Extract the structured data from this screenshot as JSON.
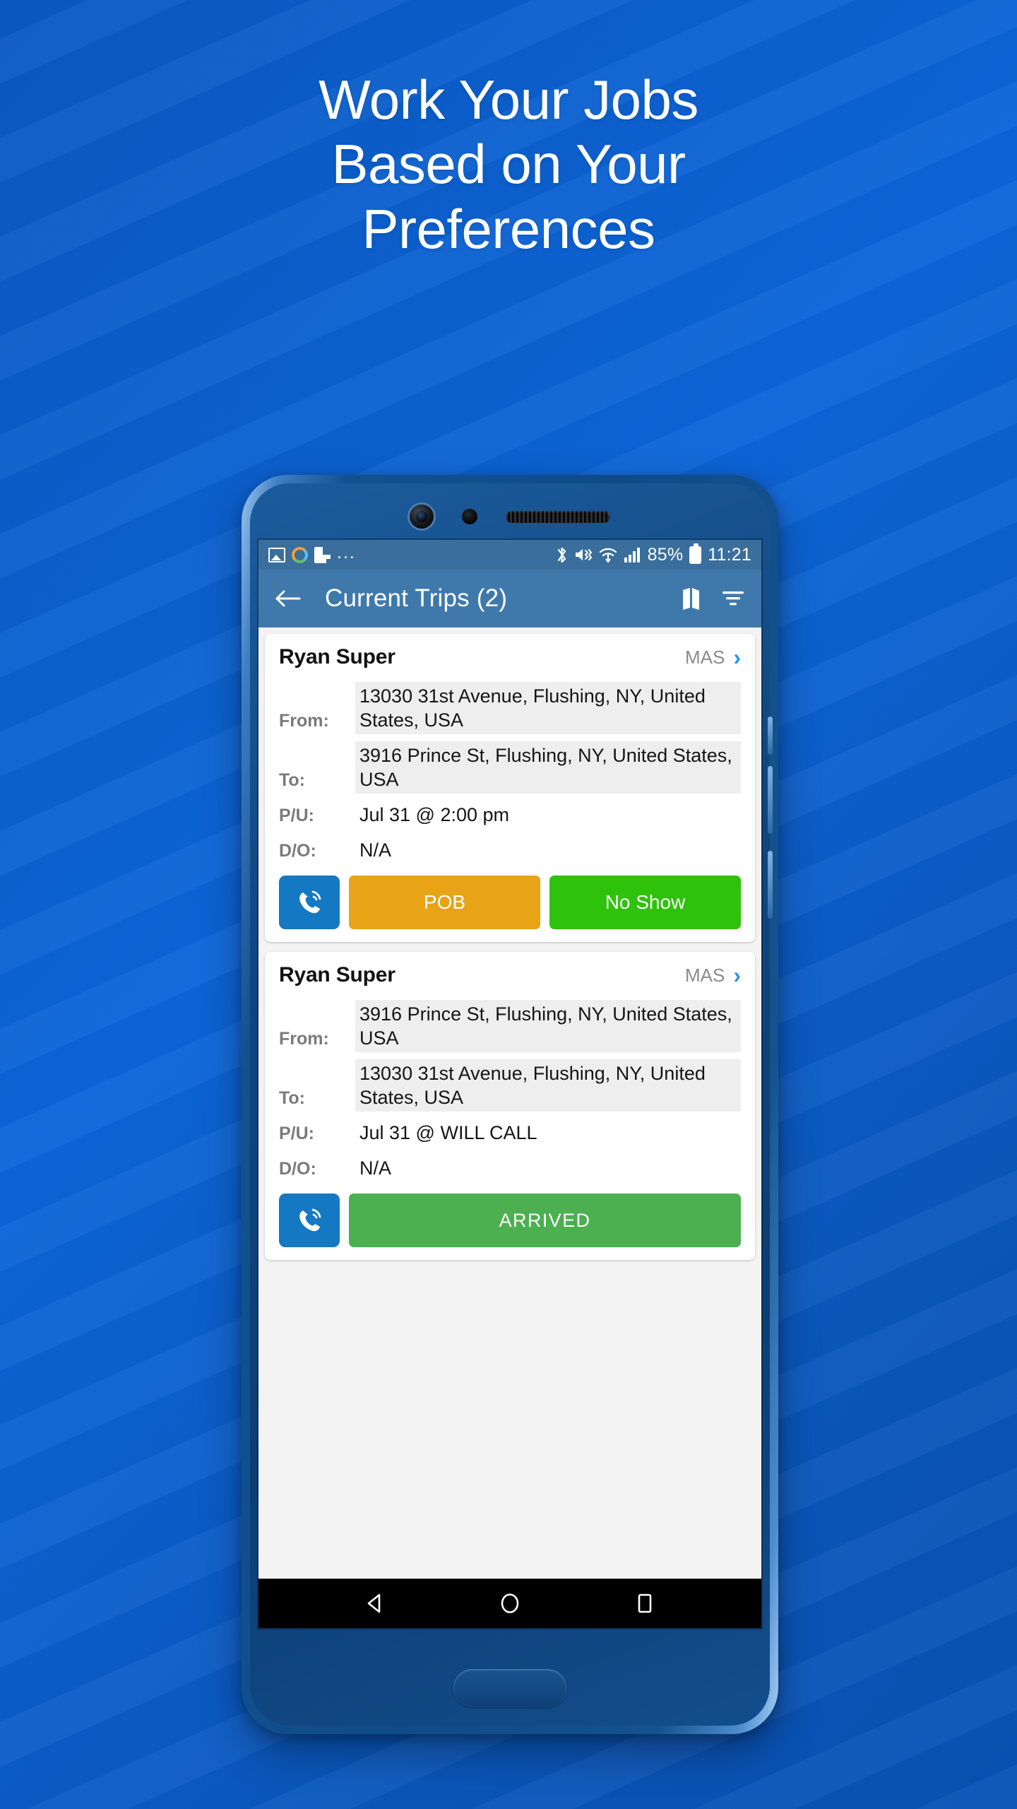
{
  "headline": {
    "line1": "Work Your Jobs",
    "line2": "Based on Your",
    "line3": "Preferences"
  },
  "status_bar": {
    "left_icons": [
      "photo-icon",
      "ring-icon",
      "flipboard-icon"
    ],
    "overflow": "...",
    "right_icons": [
      "bluetooth-icon",
      "vibrate-mute-icon",
      "wifi-icon",
      "signal-icon"
    ],
    "battery_percent": "85%",
    "battery_icon": "battery-icon",
    "time": "11:21"
  },
  "app_bar": {
    "back_icon": "back-arrow-icon",
    "title": "Current Trips (2)",
    "map_icon": "map-icon",
    "filter_icon": "filter-icon"
  },
  "trips": [
    {
      "name": "Ryan Super",
      "tag": "MAS",
      "chevron": "›",
      "rows": [
        {
          "label": "From:",
          "value": "13030 31st Avenue, Flushing, NY, United States, USA",
          "shaded": true
        },
        {
          "label": "To:",
          "value": "3916 Prince St, Flushing, NY, United States, USA",
          "shaded": true
        },
        {
          "label": "P/U:",
          "value": "Jul 31 @ 2:00 pm",
          "shaded": false
        },
        {
          "label": "D/O:",
          "value": "N/A",
          "shaded": false
        }
      ],
      "call_icon": "phone-call-icon",
      "buttons": [
        {
          "label": "POB",
          "color": "#e8a317"
        },
        {
          "label": "No Show",
          "color": "#2fc20a"
        }
      ]
    },
    {
      "name": "Ryan Super",
      "tag": "MAS",
      "chevron": "›",
      "rows": [
        {
          "label": "From:",
          "value": "3916 Prince St, Flushing, NY, United States, USA",
          "shaded": true
        },
        {
          "label": "To:",
          "value": "13030 31st Avenue, Flushing, NY, United States, USA",
          "shaded": true
        },
        {
          "label": "P/U:",
          "value": "Jul 31 @ WILL CALL",
          "shaded": false
        },
        {
          "label": "D/O:",
          "value": "N/A",
          "shaded": false
        }
      ],
      "call_icon": "phone-call-icon",
      "buttons": [
        {
          "label": "ARRIVED",
          "color": "#4caf50"
        }
      ]
    }
  ],
  "nav_bar": {
    "back": "nav-back-icon",
    "home": "nav-home-icon",
    "recents": "nav-recents-icon"
  },
  "colors": {
    "background_blue": "#0b5ecb",
    "app_bar": "#3f79ab",
    "status_bar": "#3a6e9c",
    "accent_blue": "#2196f3",
    "call_blue": "#1578c2",
    "orange": "#e8a317",
    "green_bright": "#2fc20a",
    "green_soft": "#4caf50"
  }
}
